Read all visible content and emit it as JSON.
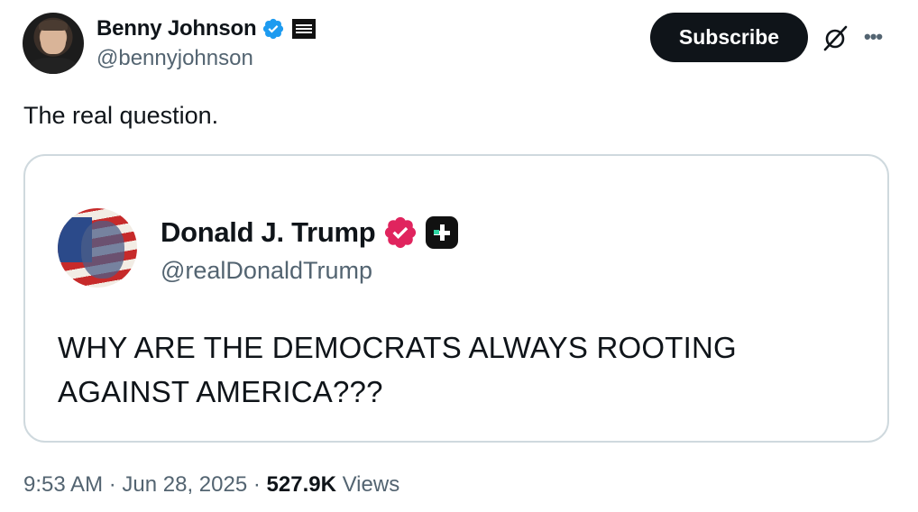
{
  "post": {
    "author_name": "Benny Johnson",
    "author_handle": "@bennyjohnson",
    "subscribe_label": "Subscribe",
    "text": "The real question.",
    "time": "9:53 AM",
    "separator": "·",
    "date": "Jun 28, 2025",
    "views_count": "527.9K",
    "views_label": "Views"
  },
  "quoted": {
    "author_name": "Donald J. Trump",
    "author_handle": "@realDonaldTrump",
    "text": "WHY ARE THE DEMOCRATS ALWAYS ROOTING AGAINST AMERICA???"
  },
  "icons": {
    "verified": "verified-badge-icon",
    "affiliate": "affiliate-badge-icon",
    "grok": "grok-icon",
    "more": "more-options-icon"
  },
  "colors": {
    "verified_blue": "#1d9bf0",
    "verified_pink": "#e0245e",
    "text": "#0f1419",
    "secondary": "#536471",
    "border": "#cfd9de"
  }
}
